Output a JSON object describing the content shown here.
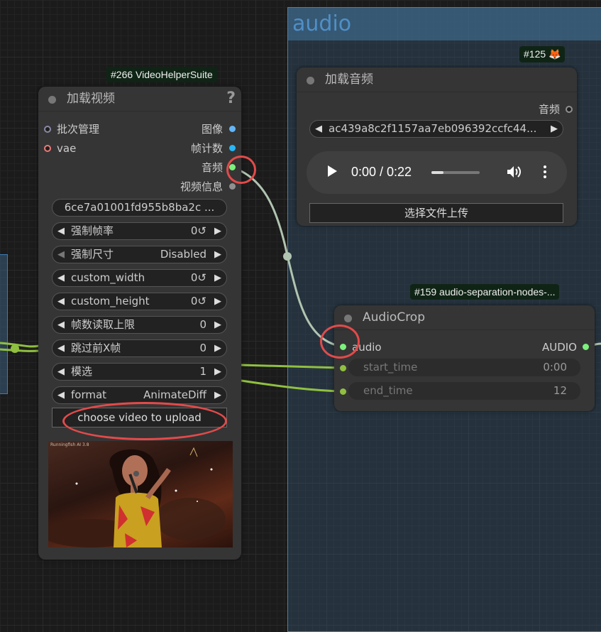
{
  "group": {
    "title": "audio"
  },
  "load_video": {
    "badge": "#266 VideoHelperSuite",
    "title": "加载视频",
    "help": "?",
    "inputs": [
      {
        "label": "批次管理",
        "color": "#8a8aa8"
      },
      {
        "label": "vae",
        "color": "#f07878"
      }
    ],
    "outputs": [
      {
        "label": "图像",
        "color": "#64b5f6"
      },
      {
        "label": "帧计数",
        "color": "#29b6f6"
      },
      {
        "label": "音频",
        "color": "#7cf07c"
      },
      {
        "label": "视频信息",
        "color": "#909090"
      }
    ],
    "file": "6ce7a01001fd955b8ba2c ...",
    "widgets": [
      {
        "label": "强制帧率",
        "value": "0↺"
      },
      {
        "label": "强制尺寸",
        "value": "Disabled"
      },
      {
        "label": "custom_width",
        "value": "0↺"
      },
      {
        "label": "custom_height",
        "value": "0↺"
      },
      {
        "label": "帧数读取上限",
        "value": "0"
      },
      {
        "label": "跳过前X帧",
        "value": "0"
      },
      {
        "label": "模选",
        "value": "1"
      },
      {
        "label": "format",
        "value": "AnimateDiff"
      }
    ],
    "upload_button": "choose video to upload",
    "preview_watermark": "Runningfish AI 3.8"
  },
  "load_audio": {
    "badge": "#125 🦊",
    "title": "加载音频",
    "output": "音频",
    "file": "ac439a8c2f1157aa7eb096392ccfc44...",
    "player": {
      "time": "0:00 / 0:22",
      "progress": 0.25
    },
    "upload_button": "选择文件上传"
  },
  "audio_crop": {
    "badge": "#159 audio-separation-nodes-...",
    "title": "AudioCrop",
    "input": "audio",
    "output": "AUDIO",
    "widgets": [
      {
        "label": "start_time",
        "value": "0:00"
      },
      {
        "label": "end_time",
        "value": "12"
      }
    ]
  },
  "colors": {
    "audio_wire": "#b0c4b0",
    "int_wire": "#90c040",
    "highlight": "#e34a4a"
  }
}
